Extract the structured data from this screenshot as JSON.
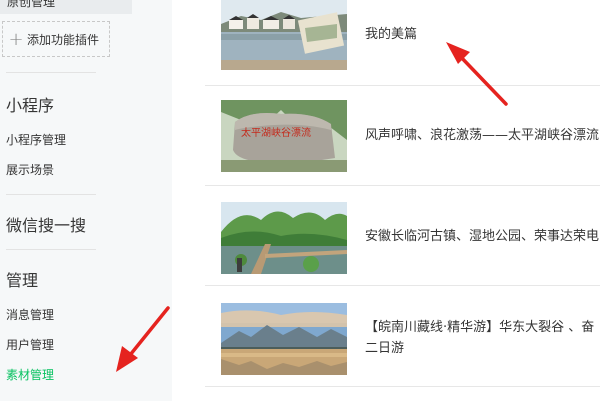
{
  "sidebar": {
    "top_item_label": "原创管理",
    "add_plugin": {
      "icon": "plus-icon",
      "label": "添加功能插件"
    },
    "sections": [
      {
        "title": "小程序",
        "items": [
          "小程序管理",
          "展示场景"
        ]
      },
      {
        "title": "微信搜一搜",
        "items": []
      },
      {
        "title": "管理",
        "items": [
          "消息管理",
          "用户管理",
          "素材管理"
        ]
      }
    ],
    "active_item": "素材管理"
  },
  "articles": [
    {
      "title": "我的美篇",
      "thumbnail": "village-lake-painting"
    },
    {
      "title": "风声呼啸、浪花激荡——太平湖峡谷漂流",
      "thumbnail": "red-calligraphy-rock"
    },
    {
      "title": "安徽长临河古镇、湿地公园、荣事达荣电",
      "thumbnail": "wetland-park-boardwalk"
    },
    {
      "title_line1": "【皖南川藏线·精华游】华东大裂谷 、奋",
      "title_line2": "二日游",
      "thumbnail": "mountain-lake-reflection"
    }
  ],
  "annotations": {
    "arrow_color": "#e5231f"
  },
  "colors": {
    "active_green": "#07c160",
    "sidebar_bg": "#f6f8f9"
  }
}
